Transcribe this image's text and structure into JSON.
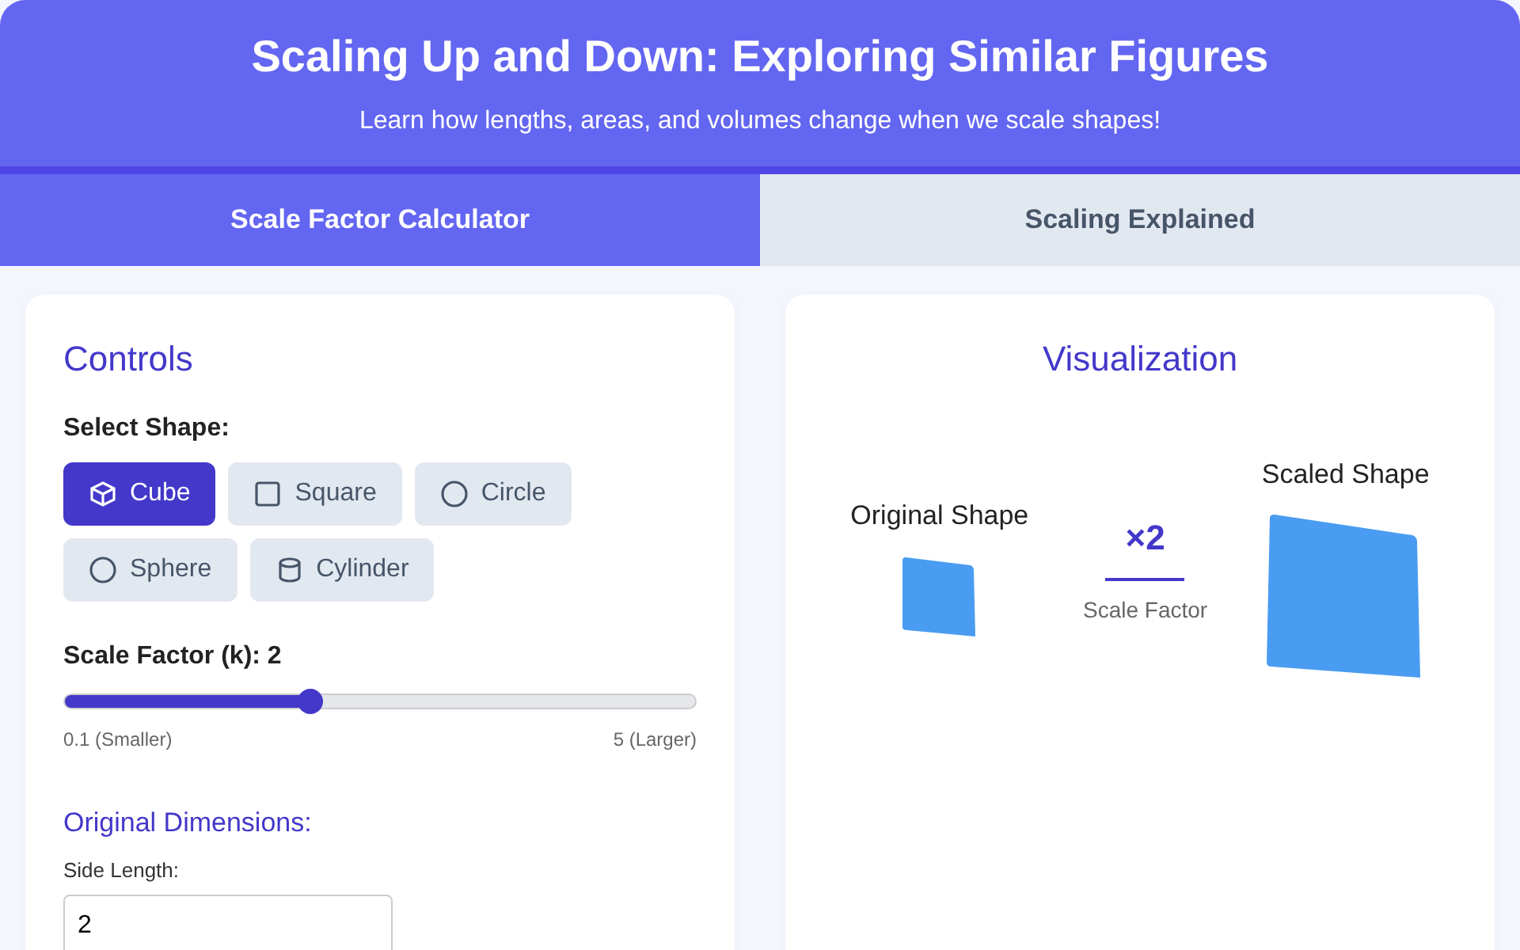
{
  "header": {
    "title": "Scaling Up and Down: Exploring Similar Figures",
    "subtitle": "Learn how lengths, areas, and volumes change when we scale shapes!"
  },
  "tabs": [
    {
      "label": "Scale Factor Calculator",
      "selected": true
    },
    {
      "label": "Scaling Explained",
      "selected": false
    }
  ],
  "controls": {
    "title": "Controls",
    "shape_label": "Select Shape:",
    "shapes": [
      {
        "kind": "cube",
        "label": "Cube",
        "selected": true
      },
      {
        "kind": "square",
        "label": "Square",
        "selected": false
      },
      {
        "kind": "circle",
        "label": "Circle",
        "selected": false
      },
      {
        "kind": "sphere",
        "label": "Sphere",
        "selected": false
      },
      {
        "kind": "cylinder",
        "label": "Cylinder",
        "selected": false
      }
    ],
    "slider": {
      "label": "Scale Factor (k): 2",
      "level": 0.39,
      "min_label": "0.1 (Smaller)",
      "max_label": "5 (Larger)"
    },
    "dimensions_title": "Original Dimensions:",
    "field_label": "Side Length:",
    "field_value": "2"
  },
  "visualization": {
    "title": "Visualization",
    "original_label": "Original Shape",
    "factor": "×2",
    "factor_caption": "Scale Factor",
    "scaled_label": "Scaled Shape"
  }
}
